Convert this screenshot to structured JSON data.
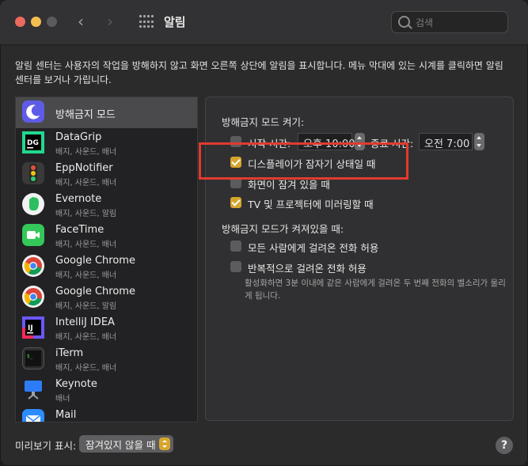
{
  "window": {
    "title": "알림"
  },
  "search": {
    "placeholder": "검색"
  },
  "description": "알림 센터는 사용자의 작업을 방해하지 않고 화면 오른쪽 상단에 알림을 표시합니다. 메뉴 막대에 있는 시계를 클릭하면 알림 센터를 보거나 가립니다.",
  "apps": [
    {
      "name": "방해금지 모드",
      "sub": "",
      "icon": "moon-icon",
      "color": "#5e5ce6",
      "selected": true
    },
    {
      "name": "DataGrip",
      "sub": "배지, 사운드, 배너",
      "icon": "datagrip-icon",
      "color": "#1b1b1b"
    },
    {
      "name": "EppNotifier",
      "sub": "배지, 사운드, 배너",
      "icon": "traffic-light-icon",
      "color": "#3a3a3a"
    },
    {
      "name": "Evernote",
      "sub": "배지, 사운드, 알림",
      "icon": "evernote-icon",
      "color": "#f2f2f2"
    },
    {
      "name": "FaceTime",
      "sub": "배지, 사운드, 배너",
      "icon": "facetime-icon",
      "color": "#34c759"
    },
    {
      "name": "Google Chrome",
      "sub": "배지, 사운드, 배너",
      "icon": "chrome-icon",
      "color": "#f2f2f2"
    },
    {
      "name": "Google Chrome",
      "sub": "배지, 사운드, 알림",
      "icon": "chrome-icon",
      "color": "#f2f2f2"
    },
    {
      "name": "IntelliJ IDEA",
      "sub": "배지, 사운드, 배너",
      "icon": "intellij-icon",
      "color": "#1b1b1b"
    },
    {
      "name": "iTerm",
      "sub": "배지, 사운드, 배너",
      "icon": "iterm-icon",
      "color": "#2c2c2c"
    },
    {
      "name": "Keynote",
      "sub": "배너",
      "icon": "keynote-icon",
      "color": "#2d7cf6"
    },
    {
      "name": "Mail",
      "sub": "",
      "icon": "mail-icon",
      "color": "#2d8cff"
    }
  ],
  "dnd": {
    "section_title": "방해금지 모드 켜기:",
    "start_label": "시작 시간:",
    "start_value": "오후 10:00",
    "end_label": "종료 시간:",
    "end_value": "오전   7:00",
    "display_sleep_label": "디스플레이가 잠자기 상태일 때",
    "screen_locked_label": "화면이 잠겨 있을 때",
    "mirroring_label": "TV 및 프로젝터에 미러링할 때",
    "when_on_title": "방해금지 모드가 켜져있을 때:",
    "allow_all_calls_label": "모든 사람에게 걸려온 전화 허용",
    "allow_repeated_label": "반복적으로 걸려온 전화 허용",
    "repeated_note": "활성화하면 3분 이내에 같은 사람에게 걸려온 두 번째 전화의 벨소리가 울리게 됩니다."
  },
  "footer": {
    "preview_label": "미리보기 표시:",
    "preview_value": "잠겨있지 않을 때",
    "help_label": "?"
  },
  "colors": {
    "accent": "#d6a52e",
    "highlight": "#e23a2e"
  }
}
